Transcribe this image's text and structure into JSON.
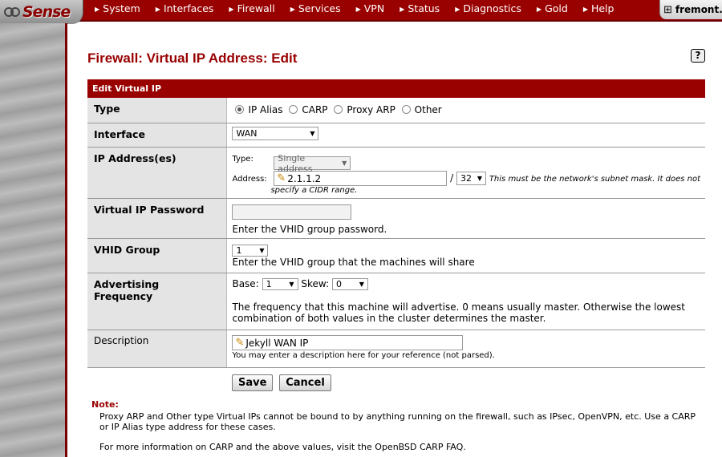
{
  "brand": {
    "logo_text": "Sense"
  },
  "nav": {
    "items": [
      "System",
      "Interfaces",
      "Firewall",
      "Services",
      "VPN",
      "Status",
      "Diagnostics",
      "Gold",
      "Help"
    ],
    "host": "fremont."
  },
  "page": {
    "title": "Firewall: Virtual IP Address: Edit",
    "help": "?"
  },
  "form": {
    "section_title": "Edit Virtual IP",
    "type": {
      "label": "Type",
      "options": [
        "IP Alias",
        "CARP",
        "Proxy ARP",
        "Other"
      ],
      "selected": "IP Alias"
    },
    "interface": {
      "label": "Interface",
      "value": "WAN"
    },
    "ip": {
      "label": "IP Address(es)",
      "type_label": "Type:",
      "type_value": "Single address",
      "address_label": "Address:",
      "address_value": "2.1.1.2",
      "slash": "/",
      "mask": "32",
      "mask_hint_1": "This must be the network's subnet mask. It does not",
      "mask_hint_2": "specify a CIDR range."
    },
    "vip_password": {
      "label": "Virtual IP Password",
      "hint": "Enter the VHID group password."
    },
    "vhid": {
      "label": "VHID Group",
      "value": "1",
      "hint": "Enter the VHID group that the machines will share"
    },
    "advfreq": {
      "label": "Advertising Frequency",
      "base_label": "Base:",
      "base_value": "1",
      "skew_label": "Skew:",
      "skew_value": "0",
      "hint": "The frequency that this machine will advertise. 0 means usually master. Otherwise the lowest combination of both values in the cluster determines the master."
    },
    "description": {
      "label": "Description",
      "value": "Jekyll WAN IP",
      "hint": "You may enter a description here for your reference (not parsed)."
    },
    "save_label": "Save",
    "cancel_label": "Cancel"
  },
  "note": {
    "title": "Note:",
    "text1": "Proxy ARP and Other type Virtual IPs cannot be bound to by anything running on the firewall, such as IPsec, OpenVPN, etc. Use a CARP or IP Alias type address for these cases.",
    "text2": "For more information on CARP and the above values, visit the OpenBSD CARP FAQ."
  },
  "colors": {
    "accent": "#990000",
    "label_bg": "#e4e4e4"
  }
}
